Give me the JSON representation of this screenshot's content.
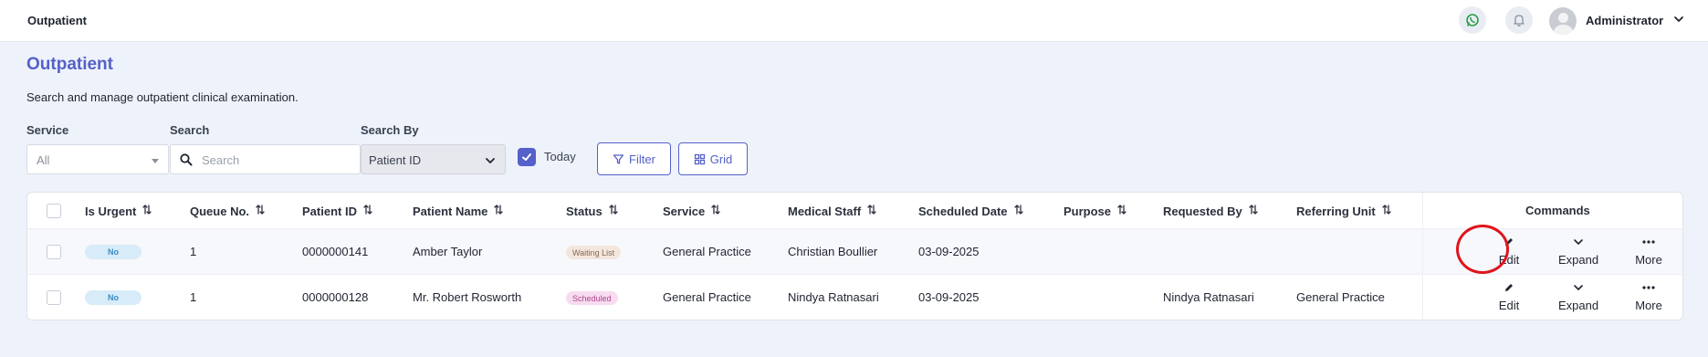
{
  "app": {
    "title": "Outpatient"
  },
  "user": {
    "name": "Administrator"
  },
  "page": {
    "title": "Outpatient",
    "subtitle": "Search and manage outpatient clinical examination."
  },
  "filters": {
    "service_label": "Service",
    "service_value": "All",
    "search_label": "Search",
    "search_placeholder": "Search",
    "search_by_label": "Search By",
    "search_by_value": "Patient ID",
    "today_label": "Today",
    "today_checked": true,
    "filter_button": "Filter",
    "grid_button": "Grid"
  },
  "table": {
    "columns": [
      "Is Urgent",
      "Queue No.",
      "Patient ID",
      "Patient Name",
      "Status",
      "Service",
      "Medical Staff",
      "Scheduled Date",
      "Purpose",
      "Requested By",
      "Referring Unit"
    ],
    "commands_header": "Commands",
    "rows": [
      {
        "is_urgent": "No",
        "queue_no": "1",
        "patient_id": "0000000141",
        "patient_name": "Amber Taylor",
        "status": "Waiting List",
        "service": "General Practice",
        "medical_staff": "Christian Boullier",
        "scheduled_date": "03-09-2025",
        "purpose": "",
        "requested_by": "",
        "referring_unit": ""
      },
      {
        "is_urgent": "No",
        "queue_no": "1",
        "patient_id": "0000000128",
        "patient_name": "Mr. Robert Rosworth",
        "status": "Scheduled",
        "service": "General Practice",
        "medical_staff": "Nindya Ratnasari",
        "scheduled_date": "03-09-2025",
        "purpose": "",
        "requested_by": "Nindya Ratnasari",
        "referring_unit": "General Practice"
      }
    ],
    "commands": {
      "edit": "Edit",
      "expand": "Expand",
      "more": "More"
    }
  },
  "colors": {
    "accent": "#5561c8",
    "status_waiting_bg": "#f3e6dd",
    "status_scheduled_bg": "#f7dcf0",
    "urgent_no_bg": "#d7ecf8",
    "annotation_circle": "#e0141c"
  },
  "icons": {
    "whatsapp": "whatsapp-icon",
    "notification": "bell-icon",
    "avatar": "user-avatar-icon",
    "search": "search-icon",
    "filter": "filter-icon",
    "grid": "grid-icon",
    "sort": "sort-icon",
    "edit": "pencil-icon",
    "expand": "chevron-down-icon",
    "more": "more-dots-icon"
  }
}
